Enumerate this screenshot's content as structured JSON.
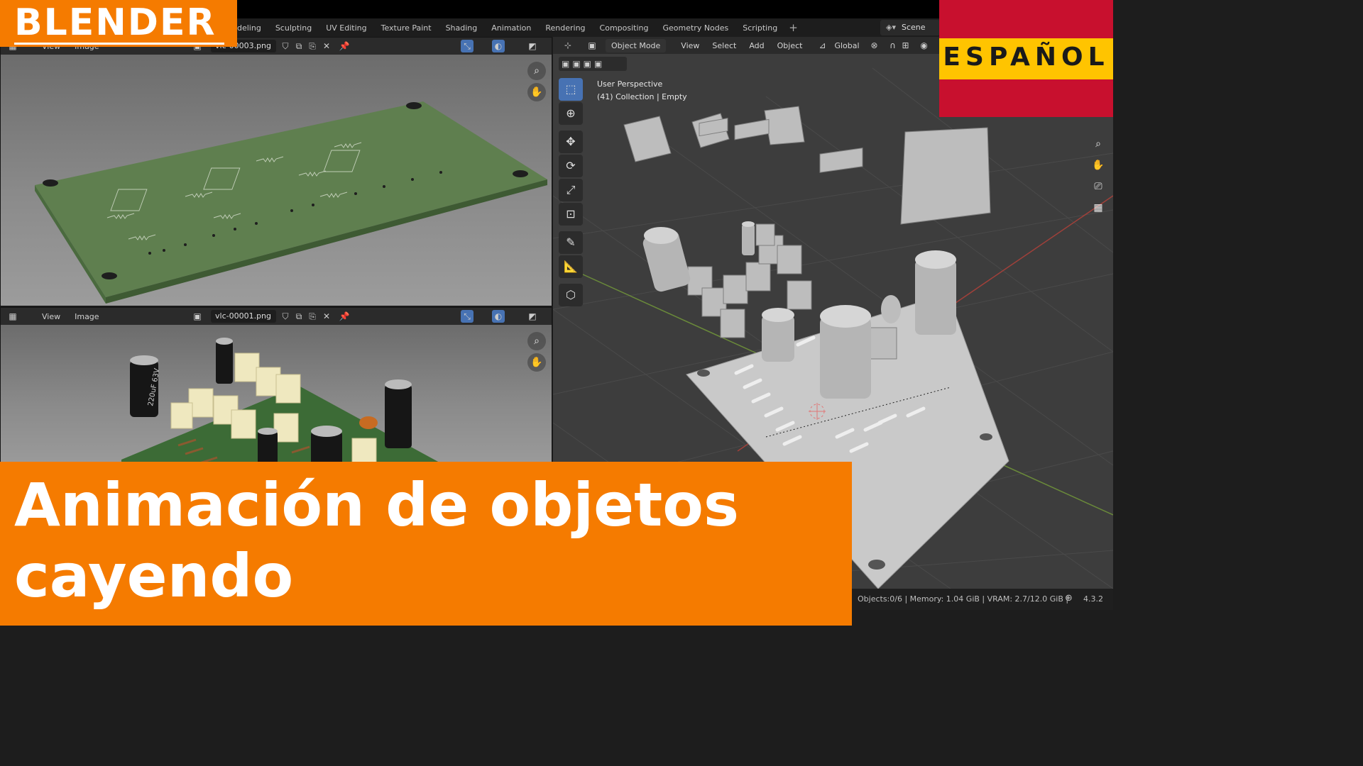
{
  "overlay": {
    "brand": "BLENDER",
    "language": "ESPAÑOL",
    "title_line1": "Animación de objetos",
    "title_line2": "cayendo"
  },
  "workspace_tabs": [
    "deling",
    "Sculpting",
    "UV Editing",
    "Texture Paint",
    "Shading",
    "Animation",
    "Rendering",
    "Compositing",
    "Geometry Nodes",
    "Scripting"
  ],
  "workspace_add": "+",
  "scene_label": "Scene",
  "image_editor_top": {
    "menu_view": "View",
    "menu_image": "Image",
    "filename": "vlc-00003.png"
  },
  "image_editor_bottom": {
    "menu_view": "View",
    "menu_image": "Image",
    "filename": "vlc-00001.png"
  },
  "viewport": {
    "mode": "Object Mode",
    "menus": [
      "View",
      "Select",
      "Add",
      "Object"
    ],
    "transform_orientation": "Global",
    "info_line1": "User Perspective",
    "info_line2": "(41) Collection | Empty"
  },
  "capacitor_label": "220uF 63V",
  "statusbar": {
    "stats": "Objects:0/6 | Memory: 1.04 GiB | VRAM: 2.7/12.0 GiB |",
    "version": "4.3.2"
  },
  "colors": {
    "accent_orange": "#f57b00",
    "pcb_green": "#5f7f4f",
    "flag_red": "#c8102e",
    "flag_yellow": "#ffc400",
    "active_tool": "#4772b3"
  }
}
